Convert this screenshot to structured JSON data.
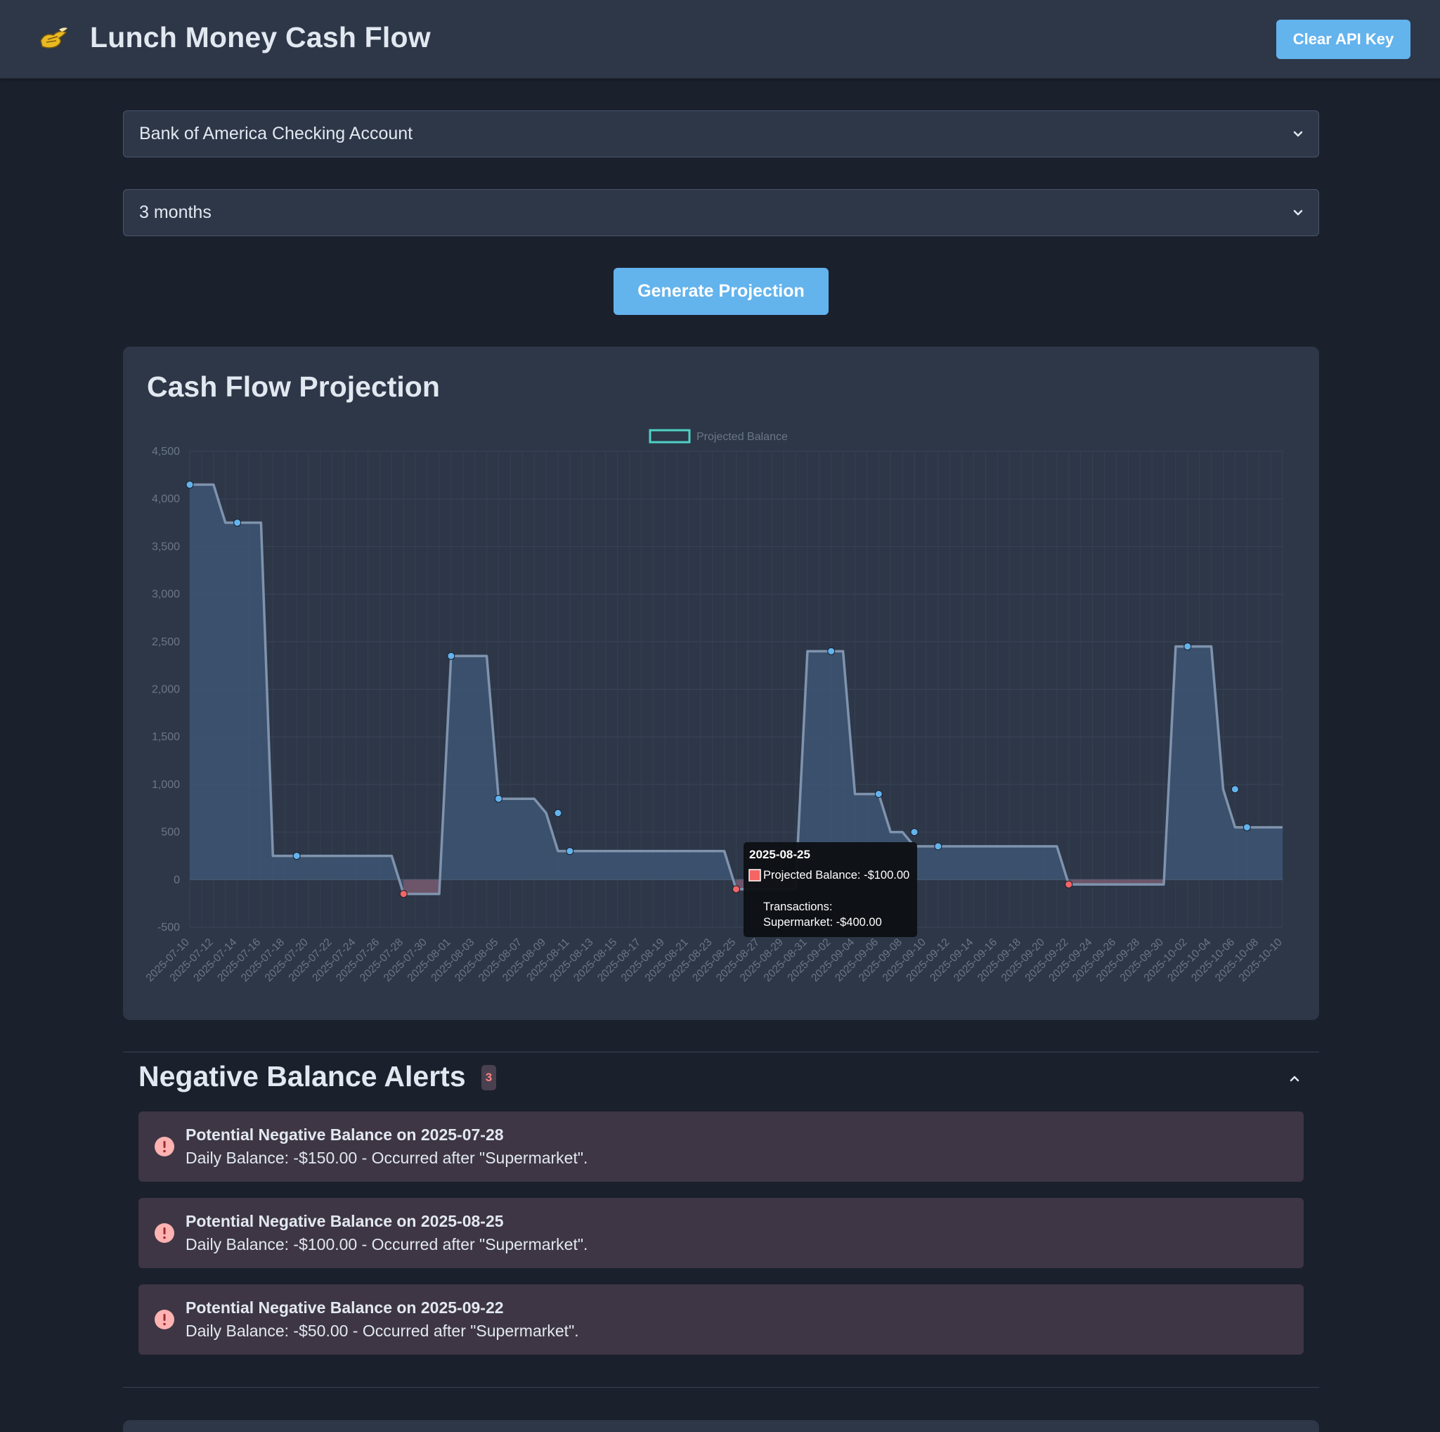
{
  "header": {
    "title": "Lunch Money Cash Flow",
    "logo_icon": "money-wings-icon",
    "clear_api_key_label": "Clear API Key"
  },
  "controls": {
    "account_selected": "Bank of America Checking Account",
    "period_selected": "3 months",
    "generate_label": "Generate Projection"
  },
  "colors": {
    "accent": "#63b3ed",
    "negative": "#f56565",
    "line": "#7f93ad",
    "legend_border": "#4fd1c5"
  },
  "chart_title": "Cash Flow Projection",
  "chart_data": {
    "type": "area",
    "legend": [
      "Projected Balance"
    ],
    "legend_position": "top-center",
    "grid": true,
    "ylim": [
      -500,
      4500
    ],
    "yticks": [
      "4,500",
      "4,000",
      "3,500",
      "3,000",
      "2,500",
      "2,000",
      "1,500",
      "1,000",
      "500",
      "0",
      "-500"
    ],
    "xticks": [
      "2025-07-10",
      "2025-07-12",
      "2025-07-14",
      "2025-07-16",
      "2025-07-18",
      "2025-07-20",
      "2025-07-22",
      "2025-07-24",
      "2025-07-26",
      "2025-07-28",
      "2025-07-30",
      "2025-08-01",
      "2025-08-03",
      "2025-08-05",
      "2025-08-07",
      "2025-08-09",
      "2025-08-11",
      "2025-08-13",
      "2025-08-15",
      "2025-08-17",
      "2025-08-19",
      "2025-08-21",
      "2025-08-23",
      "2025-08-25",
      "2025-08-27",
      "2025-08-29",
      "2025-08-31",
      "2025-09-02",
      "2025-09-04",
      "2025-09-06",
      "2025-09-08",
      "2025-09-10",
      "2025-09-12",
      "2025-09-14",
      "2025-09-16",
      "2025-09-18",
      "2025-09-20",
      "2025-09-22",
      "2025-09-24",
      "2025-09-26",
      "2025-09-28",
      "2025-09-30",
      "2025-10-02",
      "2025-10-04",
      "2025-10-06",
      "2025-10-08",
      "2025-10-10"
    ],
    "series": [
      {
        "name": "Projected Balance",
        "points": [
          {
            "x": "2025-07-10",
            "y": 4150
          },
          {
            "x": "2025-07-11",
            "y": 4150
          },
          {
            "x": "2025-07-12",
            "y": 4150
          },
          {
            "x": "2025-07-13",
            "y": 3750
          },
          {
            "x": "2025-07-14",
            "y": 3750
          },
          {
            "x": "2025-07-15",
            "y": 3750
          },
          {
            "x": "2025-07-16",
            "y": 3750
          },
          {
            "x": "2025-07-17",
            "y": 250
          },
          {
            "x": "2025-07-26",
            "y": 250
          },
          {
            "x": "2025-07-27",
            "y": 250
          },
          {
            "x": "2025-07-28",
            "y": -150
          },
          {
            "x": "2025-07-30",
            "y": -150
          },
          {
            "x": "2025-07-31",
            "y": -150
          },
          {
            "x": "2025-08-01",
            "y": 2350
          },
          {
            "x": "2025-08-03",
            "y": 2350
          },
          {
            "x": "2025-08-04",
            "y": 2350
          },
          {
            "x": "2025-08-05",
            "y": 850
          },
          {
            "x": "2025-08-08",
            "y": 850
          },
          {
            "x": "2025-08-09",
            "y": 700
          },
          {
            "x": "2025-08-10",
            "y": 300
          },
          {
            "x": "2025-08-24",
            "y": 300
          },
          {
            "x": "2025-08-25",
            "y": -100
          },
          {
            "x": "2025-08-30",
            "y": -100
          },
          {
            "x": "2025-08-31",
            "y": 2400
          },
          {
            "x": "2025-09-02",
            "y": 2400
          },
          {
            "x": "2025-09-03",
            "y": 2400
          },
          {
            "x": "2025-09-04",
            "y": 900
          },
          {
            "x": "2025-09-06",
            "y": 900
          },
          {
            "x": "2025-09-07",
            "y": 500
          },
          {
            "x": "2025-09-08",
            "y": 500
          },
          {
            "x": "2025-09-09",
            "y": 350
          },
          {
            "x": "2025-09-20",
            "y": 350
          },
          {
            "x": "2025-09-21",
            "y": 350
          },
          {
            "x": "2025-09-22",
            "y": -50
          },
          {
            "x": "2025-09-29",
            "y": -50
          },
          {
            "x": "2025-09-30",
            "y": -50
          },
          {
            "x": "2025-10-01",
            "y": 2450
          },
          {
            "x": "2025-10-03",
            "y": 2450
          },
          {
            "x": "2025-10-04",
            "y": 2450
          },
          {
            "x": "2025-10-05",
            "y": 950
          },
          {
            "x": "2025-10-06",
            "y": 550
          },
          {
            "x": "2025-10-10",
            "y": 550
          }
        ],
        "markers": [
          {
            "x": "2025-07-10",
            "y": 4150
          },
          {
            "x": "2025-07-14",
            "y": 3750
          },
          {
            "x": "2025-07-19",
            "y": 250
          },
          {
            "x": "2025-07-28",
            "y": -150
          },
          {
            "x": "2025-08-01",
            "y": 2350
          },
          {
            "x": "2025-08-05",
            "y": 850
          },
          {
            "x": "2025-08-10",
            "y": 700
          },
          {
            "x": "2025-08-11",
            "y": 300
          },
          {
            "x": "2025-08-25",
            "y": -100
          },
          {
            "x": "2025-09-02",
            "y": 2400
          },
          {
            "x": "2025-09-06",
            "y": 900
          },
          {
            "x": "2025-09-09",
            "y": 500
          },
          {
            "x": "2025-09-11",
            "y": 350
          },
          {
            "x": "2025-09-22",
            "y": -50
          },
          {
            "x": "2025-10-02",
            "y": 2450
          },
          {
            "x": "2025-10-06",
            "y": 950
          },
          {
            "x": "2025-10-07",
            "y": 550
          }
        ]
      }
    ],
    "tooltip": {
      "date": "2025-08-25",
      "line1": "Projected Balance: -$100.00",
      "line2": "Transactions:",
      "line3": "Supermarket: -$400.00"
    }
  },
  "alerts": {
    "title": "Negative Balance Alerts",
    "count": "3",
    "alert_icon": "exclamation-circle-icon",
    "collapse_icon": "chevron-up-icon",
    "items": [
      {
        "title": "Potential Negative Balance on 2025-07-28",
        "body": "Daily Balance: -$150.00 - Occurred after \"Supermarket\"."
      },
      {
        "title": "Potential Negative Balance on 2025-08-25",
        "body": "Daily Balance: -$100.00 - Occurred after \"Supermarket\"."
      },
      {
        "title": "Potential Negative Balance on 2025-09-22",
        "body": "Daily Balance: -$50.00 - Occurred after \"Supermarket\"."
      }
    ]
  }
}
